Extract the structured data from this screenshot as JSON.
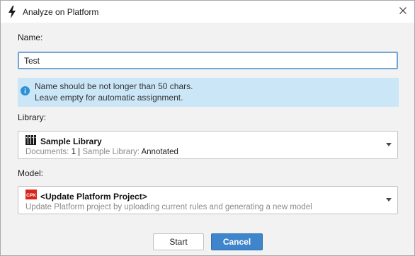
{
  "window": {
    "title": "Analyze on Platform",
    "title_icon": "lightning-bolt-icon",
    "close_icon": "close-icon"
  },
  "name": {
    "label": "Name:",
    "value": "Test"
  },
  "info": {
    "icon": "info-icon",
    "line1": "Name should be not longer than 50 chars.",
    "line2": "Leave empty for automatic assignment."
  },
  "library": {
    "label": "Library:",
    "icon": "library-books-icon",
    "title": "Sample Library",
    "documents_label": "Documents:",
    "documents_value": "1",
    "separator": "|",
    "library_label": "Sample Library:",
    "library_value": "Annotated"
  },
  "model": {
    "label": "Model:",
    "icon": "cpk-project-icon",
    "icon_text": "CPK",
    "title": "<Update Platform Project>",
    "description": "Update Platform project by uploading current rules and generating a new model"
  },
  "buttons": {
    "start": "Start",
    "cancel": "Cancel"
  },
  "colors": {
    "accent": "#3f85cc",
    "info_bg": "#cbe6f7",
    "input_focus": "#6fa6d6",
    "cpk_red": "#d8261c"
  }
}
